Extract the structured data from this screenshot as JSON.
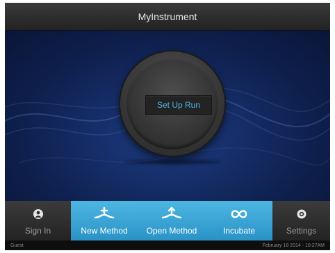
{
  "window": {
    "title": "MyInstrument"
  },
  "main": {
    "setup_label": "Set Up Run"
  },
  "nav": {
    "sign_in": "Sign In",
    "new_method": "New Method",
    "open_method": "Open Method",
    "incubate": "Incubate",
    "settings": "Settings"
  },
  "status": {
    "user": "Guest",
    "datetime": "February 18 2014 - 10:27AM"
  },
  "colors": {
    "accent": "#2a93c6",
    "setup_text": "#4fb3e8",
    "background": "#0b1a3e"
  }
}
